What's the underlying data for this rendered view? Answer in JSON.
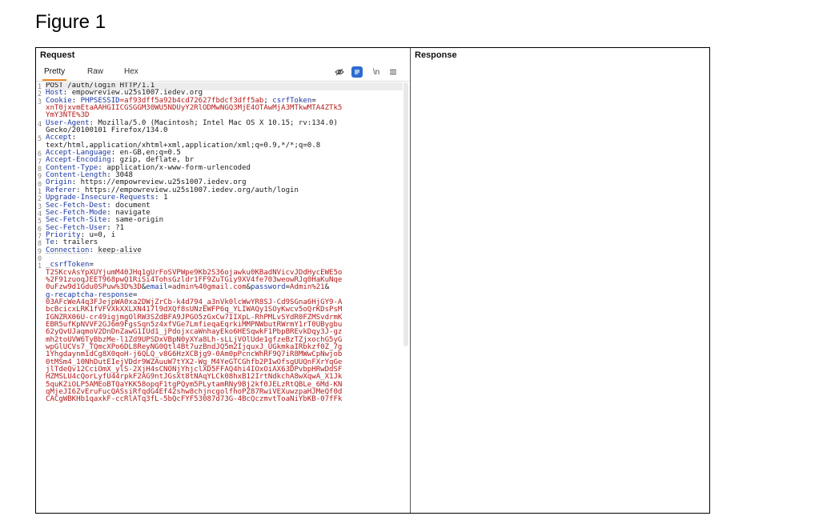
{
  "figure_title": "Figure 1",
  "request": {
    "title": "Request",
    "tabs": [
      "Pretty",
      "Raw",
      "Hex"
    ],
    "active_tab": "Pretty",
    "toolbar": {
      "icons": [
        "eye-slash-icon",
        "render-icon",
        "newline-icon",
        "menu-icon"
      ],
      "newline_label": "\\n"
    },
    "line_numbers": [
      "1",
      "2",
      "3",
      "",
      "",
      "4",
      "",
      "5",
      "",
      "6",
      "7",
      "8",
      "9",
      "0",
      "1",
      "2",
      "3",
      "4",
      "5",
      "6",
      "7",
      "8",
      "9",
      "0",
      "1"
    ],
    "lines": [
      [
        {
          "t": "POST /auth/login HTTP/1.1",
          "c": ""
        }
      ],
      [
        {
          "t": "Host",
          "c": "k"
        },
        {
          "t": ": empowreview.u25s1007.iedev.org",
          "c": ""
        }
      ],
      [
        {
          "t": "Cookie",
          "c": "k"
        },
        {
          "t": ": ",
          "c": ""
        },
        {
          "t": "PHPSESSID",
          "c": "k"
        },
        {
          "t": "=af93dff5a92b4cd72627fbdcf3dff5ab",
          "c": "r"
        },
        {
          "t": "; ",
          "c": ""
        },
        {
          "t": "csrfToken",
          "c": "k"
        },
        {
          "t": "=",
          "c": ""
        }
      ],
      [
        {
          "t": "xnT0jxvmEtaAAHGIICGSGGM30WU5NDUyY2RlODMwNGQ3MjE4OTAwMjA3MTkwMTA4ZTk5",
          "c": "r"
        }
      ],
      [
        {
          "t": "YmY3NTE%3D",
          "c": "r"
        }
      ],
      [
        {
          "t": "User-Agent",
          "c": "k"
        },
        {
          "t": ": Mozilla/5.0 (Macintosh; Intel Mac OS X 10.15; rv:134.0)",
          "c": ""
        }
      ],
      [
        {
          "t": "Gecko/20100101 Firefox/134.0",
          "c": ""
        }
      ],
      [
        {
          "t": "Accept",
          "c": "k"
        },
        {
          "t": ":",
          "c": ""
        }
      ],
      [
        {
          "t": "text/html,application/xhtml+xml,application/xml;q=0.9,*/*;q=0.8",
          "c": ""
        }
      ],
      [
        {
          "t": "Accept-Language",
          "c": "k"
        },
        {
          "t": ": en-GB,en;q=0.5",
          "c": ""
        }
      ],
      [
        {
          "t": "Accept-Encoding",
          "c": "k"
        },
        {
          "t": ": gzip, deflate, br",
          "c": ""
        }
      ],
      [
        {
          "t": "Content-Type",
          "c": "k"
        },
        {
          "t": ": application/x-www-form-urlencoded",
          "c": ""
        }
      ],
      [
        {
          "t": "Content-Length",
          "c": "k"
        },
        {
          "t": ": 3048",
          "c": ""
        }
      ],
      [
        {
          "t": "Origin",
          "c": "k"
        },
        {
          "t": ": https://empowreview.u25s1007.iedev.org",
          "c": ""
        }
      ],
      [
        {
          "t": "Referer",
          "c": "k"
        },
        {
          "t": ": https://empowreview.u25s1007.iedev.org/auth/login",
          "c": ""
        }
      ],
      [
        {
          "t": "Upgrade-Insecure-Requests",
          "c": "k"
        },
        {
          "t": ": 1",
          "c": ""
        }
      ],
      [
        {
          "t": "Sec-Fetch-Dest",
          "c": "k"
        },
        {
          "t": ": document",
          "c": ""
        }
      ],
      [
        {
          "t": "Sec-Fetch-Mode",
          "c": "k"
        },
        {
          "t": ": navigate",
          "c": ""
        }
      ],
      [
        {
          "t": "Sec-Fetch-Site",
          "c": "k"
        },
        {
          "t": ": same-origin",
          "c": ""
        }
      ],
      [
        {
          "t": "Sec-Fetch-User",
          "c": "k"
        },
        {
          "t": ": ?1",
          "c": ""
        }
      ],
      [
        {
          "t": "Priority",
          "c": "k"
        },
        {
          "t": ": u=0, i",
          "c": ""
        }
      ],
      [
        {
          "t": "Te",
          "c": "k"
        },
        {
          "t": ": trailers",
          "c": ""
        }
      ],
      [
        {
          "t": "Connection",
          "c": "k dot"
        },
        {
          "t": ": ",
          "c": ""
        },
        {
          "t": "keep-alive",
          "c": "dot"
        }
      ],
      [
        {
          "t": "",
          "c": ""
        }
      ],
      [
        {
          "t": "_csrfToken",
          "c": "k"
        },
        {
          "t": "=",
          "c": ""
        }
      ],
      [
        {
          "t": "T2SKcvAsYpXUYjumM40JHq1gUrFoSVPWpe9Kb2S36ojawku0KBadNVicvJDdHycEWE5o",
          "c": "r"
        }
      ],
      [
        {
          "t": "%2F91zuoqJEET968pwQ1RiSi4TohsGzldr1FF9ZuTGiy9XV4fe703weowRJq0HaKuNqe",
          "c": "r"
        }
      ],
      [
        {
          "t": "0uFzw9d1Gdu0SPuw%3D%3D",
          "c": "r"
        },
        {
          "t": "&",
          "c": ""
        },
        {
          "t": "email",
          "c": "k"
        },
        {
          "t": "=",
          "c": ""
        },
        {
          "t": "admin%40gmail.com",
          "c": "r"
        },
        {
          "t": "&",
          "c": ""
        },
        {
          "t": "password",
          "c": "k"
        },
        {
          "t": "=",
          "c": ""
        },
        {
          "t": "Admin%21",
          "c": "r"
        },
        {
          "t": "&",
          "c": ""
        }
      ],
      [
        {
          "t": "g-recaptcha-response",
          "c": "k"
        },
        {
          "t": "=",
          "c": ""
        }
      ],
      [
        {
          "t": "03AFcWeA4q3FJejpWA0xa2DWjZrCb-k4d794_a3nVk0lcWwYR8SJ-Cd9SGna6HjGY9-A",
          "c": "r"
        }
      ],
      [
        {
          "t": "bcBcicxLRK1fVFVXkXXLXN417l9dXQf8sUNzEWFP6q_YLIWAQy1SOyKwcv5oQrKDsPsM",
          "c": "r"
        }
      ],
      [
        {
          "t": "IGNZRX06U-cr49igjmgOlRW3SZdBFA9JPGO5zGxCw7IIXpL-RhPMLvSYdR0FZMSvdrmK",
          "c": "r"
        }
      ],
      [
        {
          "t": "EBR5ufKpNVVF2GJ6m9FgsSqn5z4xfVGe7LmfieqaEqrkiMMPNWbutRWrmY1rT0UBygbu",
          "c": "r"
        }
      ],
      [
        {
          "t": "62yQvUJaqmoV2DnDnZawG1IUd1_jPdojxcaWnhayEko6HESqwkF1PbpBREvkDqy3J-gz",
          "c": "r"
        }
      ],
      [
        {
          "t": "mh2toUVW6TyBbzMe-l1Zd9UPSDxVBpN0yXYa8Lh-sLLjVOlUde1gfzeBzTZjxochG5yG",
          "c": "r"
        }
      ],
      [
        {
          "t": "wpGlUCVs7_TQmcXPo6DL8ReyNG0Qtl4Bt7uzBndJQ5m2IjquxJ_UGkmkaIRbkzf0Z_7g",
          "c": "r"
        }
      ],
      [
        {
          "t": "1Yhgdaynm1dCg8X0qoH-j6QLQ_v8G6HzXCBjg9-0Am0pPcncWhRF9Q7iR8MWwCpNwjob",
          "c": "r"
        }
      ],
      [
        {
          "t": "0tMSm4_10NhDutEIejVDdr9WZAuuW7tYX2-Wg_M4YeGTCGhfb2PIwOfsgUUQnFXrYqGe",
          "c": "r"
        }
      ],
      [
        {
          "t": "jlTdeQv12CciOmX_ylS-2XjH4sCNONjYhjclXD5FFAQ4hi4IOxOiAX63DPvbpHRwDdSF",
          "c": "r"
        }
      ],
      [
        {
          "t": "HZMSLU4cQorLyfU44rpkF2AG9ntJGsXt8tNAqYLCk08hxB12IrtNdkchA8wXqwA_X1Jk",
          "c": "r"
        }
      ],
      [
        {
          "t": "5quKZiOLP5AMEoBTQaYKK58opqF1tgPQym5PLytamRNy9Bj2kf0JELzRtQBLe_6Md-KN",
          "c": "r"
        }
      ],
      [
        {
          "t": "qMjeJI6ZvEruFucQASsiRfqdG4Ef42shw8chjncgolfhoPZ87RwiVEXuwzpaHJMeQf0d",
          "c": "r"
        }
      ],
      [
        {
          "t": "CACgWBKHb1qaxkF-ccRlATq3fL-5bQcFYF53087d73G-4BcQczmvtToaNiYbKB-07fFk",
          "c": "r"
        }
      ]
    ]
  },
  "response": {
    "title": "Response"
  }
}
